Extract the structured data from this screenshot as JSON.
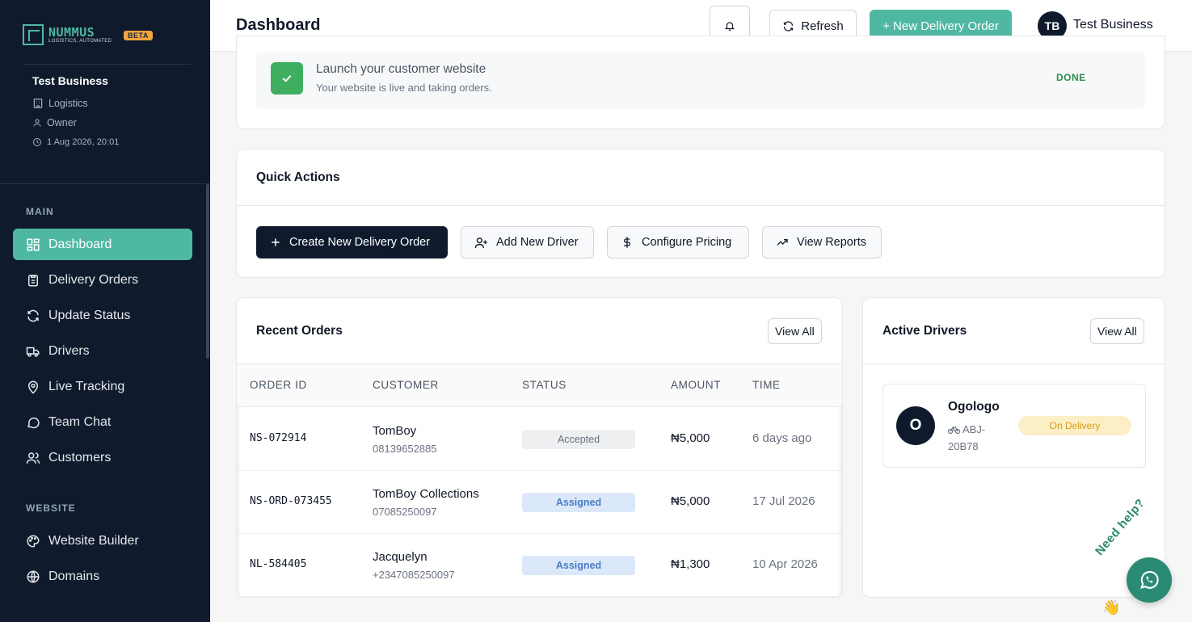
{
  "brand": {
    "name": "NUMMUS",
    "tagline": "LOGISTICS, AUTOMATED",
    "badge": "BETA"
  },
  "business": {
    "name": "Test Business",
    "industry": "Logistics",
    "role": "Owner",
    "datetime": "1 Aug 2026, 20:01"
  },
  "sidebar": {
    "main_label": "MAIN",
    "main_items": [
      {
        "label": "Dashboard",
        "icon": "grid-icon",
        "active": true
      },
      {
        "label": "Delivery Orders",
        "icon": "clipboard-icon"
      },
      {
        "label": "Update Status",
        "icon": "refresh-icon"
      },
      {
        "label": "Drivers",
        "icon": "truck-icon"
      },
      {
        "label": "Live Tracking",
        "icon": "map-pin-icon"
      },
      {
        "label": "Team Chat",
        "icon": "chat-icon"
      },
      {
        "label": "Customers",
        "icon": "users-icon"
      }
    ],
    "website_label": "WEBSITE",
    "website_items": [
      {
        "label": "Website Builder",
        "icon": "palette-icon"
      },
      {
        "label": "Domains",
        "icon": "globe-icon"
      }
    ]
  },
  "header": {
    "title": "Dashboard",
    "refresh_label": "Refresh",
    "new_order_label": "+ New Delivery Order",
    "avatar_initials": "TB",
    "user_name": "Test Business"
  },
  "launch": {
    "title": "Launch your customer website",
    "subtitle": "Your website is live and taking orders.",
    "status": "DONE"
  },
  "quick_actions": {
    "title": "Quick Actions",
    "buttons": [
      {
        "label": "Create New Delivery Order",
        "icon": "plus-icon"
      },
      {
        "label": "Add New Driver",
        "icon": "user-plus-icon"
      },
      {
        "label": "Configure Pricing",
        "icon": "dollar-icon"
      },
      {
        "label": "View Reports",
        "icon": "trending-up-icon"
      }
    ]
  },
  "recent_orders": {
    "title": "Recent Orders",
    "view_all": "View All",
    "columns": [
      "ORDER ID",
      "CUSTOMER",
      "STATUS",
      "AMOUNT",
      "TIME"
    ],
    "rows": [
      {
        "id": "NS-072914",
        "customer": "TomBoy",
        "phone": "08139652885",
        "status": "Accepted",
        "amount": "₦5,000",
        "time": "6 days ago"
      },
      {
        "id": "NS-ORD-073455",
        "customer": "TomBoy Collections",
        "phone": "07085250097",
        "status": "Assigned",
        "amount": "₦5,000",
        "time": "17 Jul 2026"
      },
      {
        "id": "NL-584405",
        "customer": "Jacquelyn",
        "phone": "+2347085250097",
        "status": "Assigned",
        "amount": "₦1,300",
        "time": "10 Apr 2026"
      }
    ]
  },
  "active_drivers": {
    "title": "Active Drivers",
    "view_all": "View All",
    "drivers": [
      {
        "initial": "O",
        "name": "Ogologo",
        "plate": "ABJ-20B78",
        "status": "On Delivery"
      }
    ]
  },
  "help": {
    "label": "Need help?"
  },
  "colors": {
    "accent": "#4fb8a3",
    "sidebar_bg": "#0f1b2d",
    "success": "#3fae5f",
    "whatsapp": "#2b8a73"
  }
}
